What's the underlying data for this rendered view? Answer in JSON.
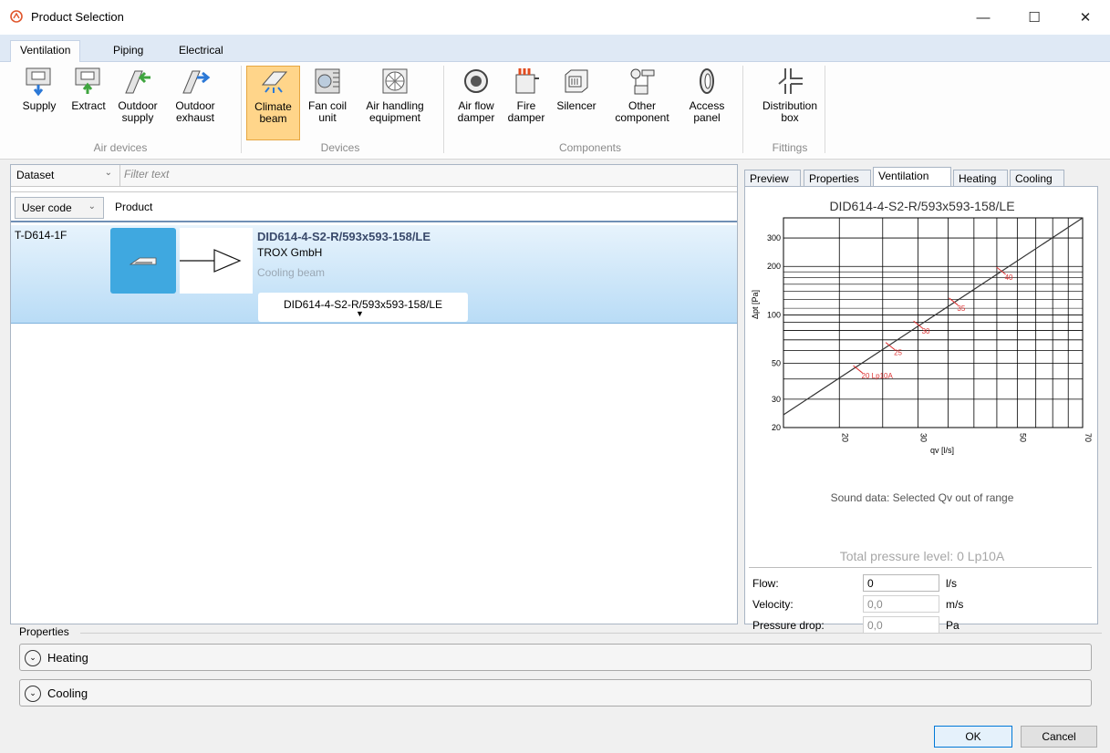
{
  "window": {
    "title": "Product Selection",
    "minimize": "—",
    "maximize": "☐",
    "close": "✕"
  },
  "ribbon": {
    "tabs": [
      "Ventilation",
      "Piping",
      "Electrical"
    ],
    "buttons": [
      {
        "label1": "Supply",
        "label2": ""
      },
      {
        "label1": "Extract",
        "label2": ""
      },
      {
        "label1": "Outdoor",
        "label2": "supply"
      },
      {
        "label1": "Outdoor",
        "label2": "exhaust"
      },
      {
        "label1": "Climate",
        "label2": "beam"
      },
      {
        "label1": "Fan coil",
        "label2": "unit"
      },
      {
        "label1": "Air handling",
        "label2": "equipment"
      },
      {
        "label1": "Air flow",
        "label2": "damper"
      },
      {
        "label1": "Fire",
        "label2": "damper"
      },
      {
        "label1": "Silencer",
        "label2": ""
      },
      {
        "label1": "Other",
        "label2": "component"
      },
      {
        "label1": "Access",
        "label2": "panel"
      },
      {
        "label1": "Distribution",
        "label2": "box"
      }
    ],
    "groups": [
      "Air devices",
      "Devices",
      "Components",
      "Fittings"
    ]
  },
  "filter": {
    "dataset": "Dataset",
    "placeholder": "Filter text"
  },
  "columns": {
    "usercode": "User code",
    "product": "Product"
  },
  "product": {
    "code": "T-D614-1F",
    "name": "DID614-4-S2-R/593x593-158/LE",
    "manufacturer": "TROX GmbH",
    "type": "Cooling beam",
    "variant": "DID614-4-S2-R/593x593-158/LE"
  },
  "right_tabs": [
    "Preview",
    "Properties",
    "Ventilation",
    "Heating",
    "Cooling"
  ],
  "chart_data": {
    "type": "line",
    "title": "DID614-4-S2-R/593x593-158/LE",
    "xlabel": "qv [l/s]",
    "ylabel": "Δpt [Pa]",
    "xscale": "log",
    "yscale": "log",
    "xlim": [
      15,
      70
    ],
    "ylim": [
      20,
      400
    ],
    "x_ticks": [
      20,
      30,
      50,
      70
    ],
    "y_ticks": [
      20,
      30,
      50,
      100,
      200,
      300
    ],
    "series": [
      {
        "x": [
          15,
          70
        ],
        "y": [
          24,
          400
        ]
      }
    ],
    "annotations": [
      {
        "x": 22,
        "y": 46,
        "text": "20 Lp10A"
      },
      {
        "x": 26,
        "y": 64,
        "text": "25"
      },
      {
        "x": 30,
        "y": 87,
        "text": "30"
      },
      {
        "x": 36,
        "y": 121,
        "text": "35"
      },
      {
        "x": 46,
        "y": 188,
        "text": "40"
      }
    ],
    "grid": true
  },
  "sound_message": "Sound data: Selected Qv out of range",
  "total_pressure": "Total pressure level: 0 Lp10A",
  "fields": [
    {
      "label": "Flow:",
      "value": "0",
      "unit": "l/s"
    },
    {
      "label": "Velocity:",
      "value": "0,0",
      "unit": "m/s"
    },
    {
      "label": "Pressure drop:",
      "value": "0,0",
      "unit": "Pa"
    }
  ],
  "properties": {
    "label": "Properties",
    "heating": "Heating",
    "cooling": "Cooling"
  },
  "buttons": {
    "ok": "OK",
    "cancel": "Cancel"
  }
}
